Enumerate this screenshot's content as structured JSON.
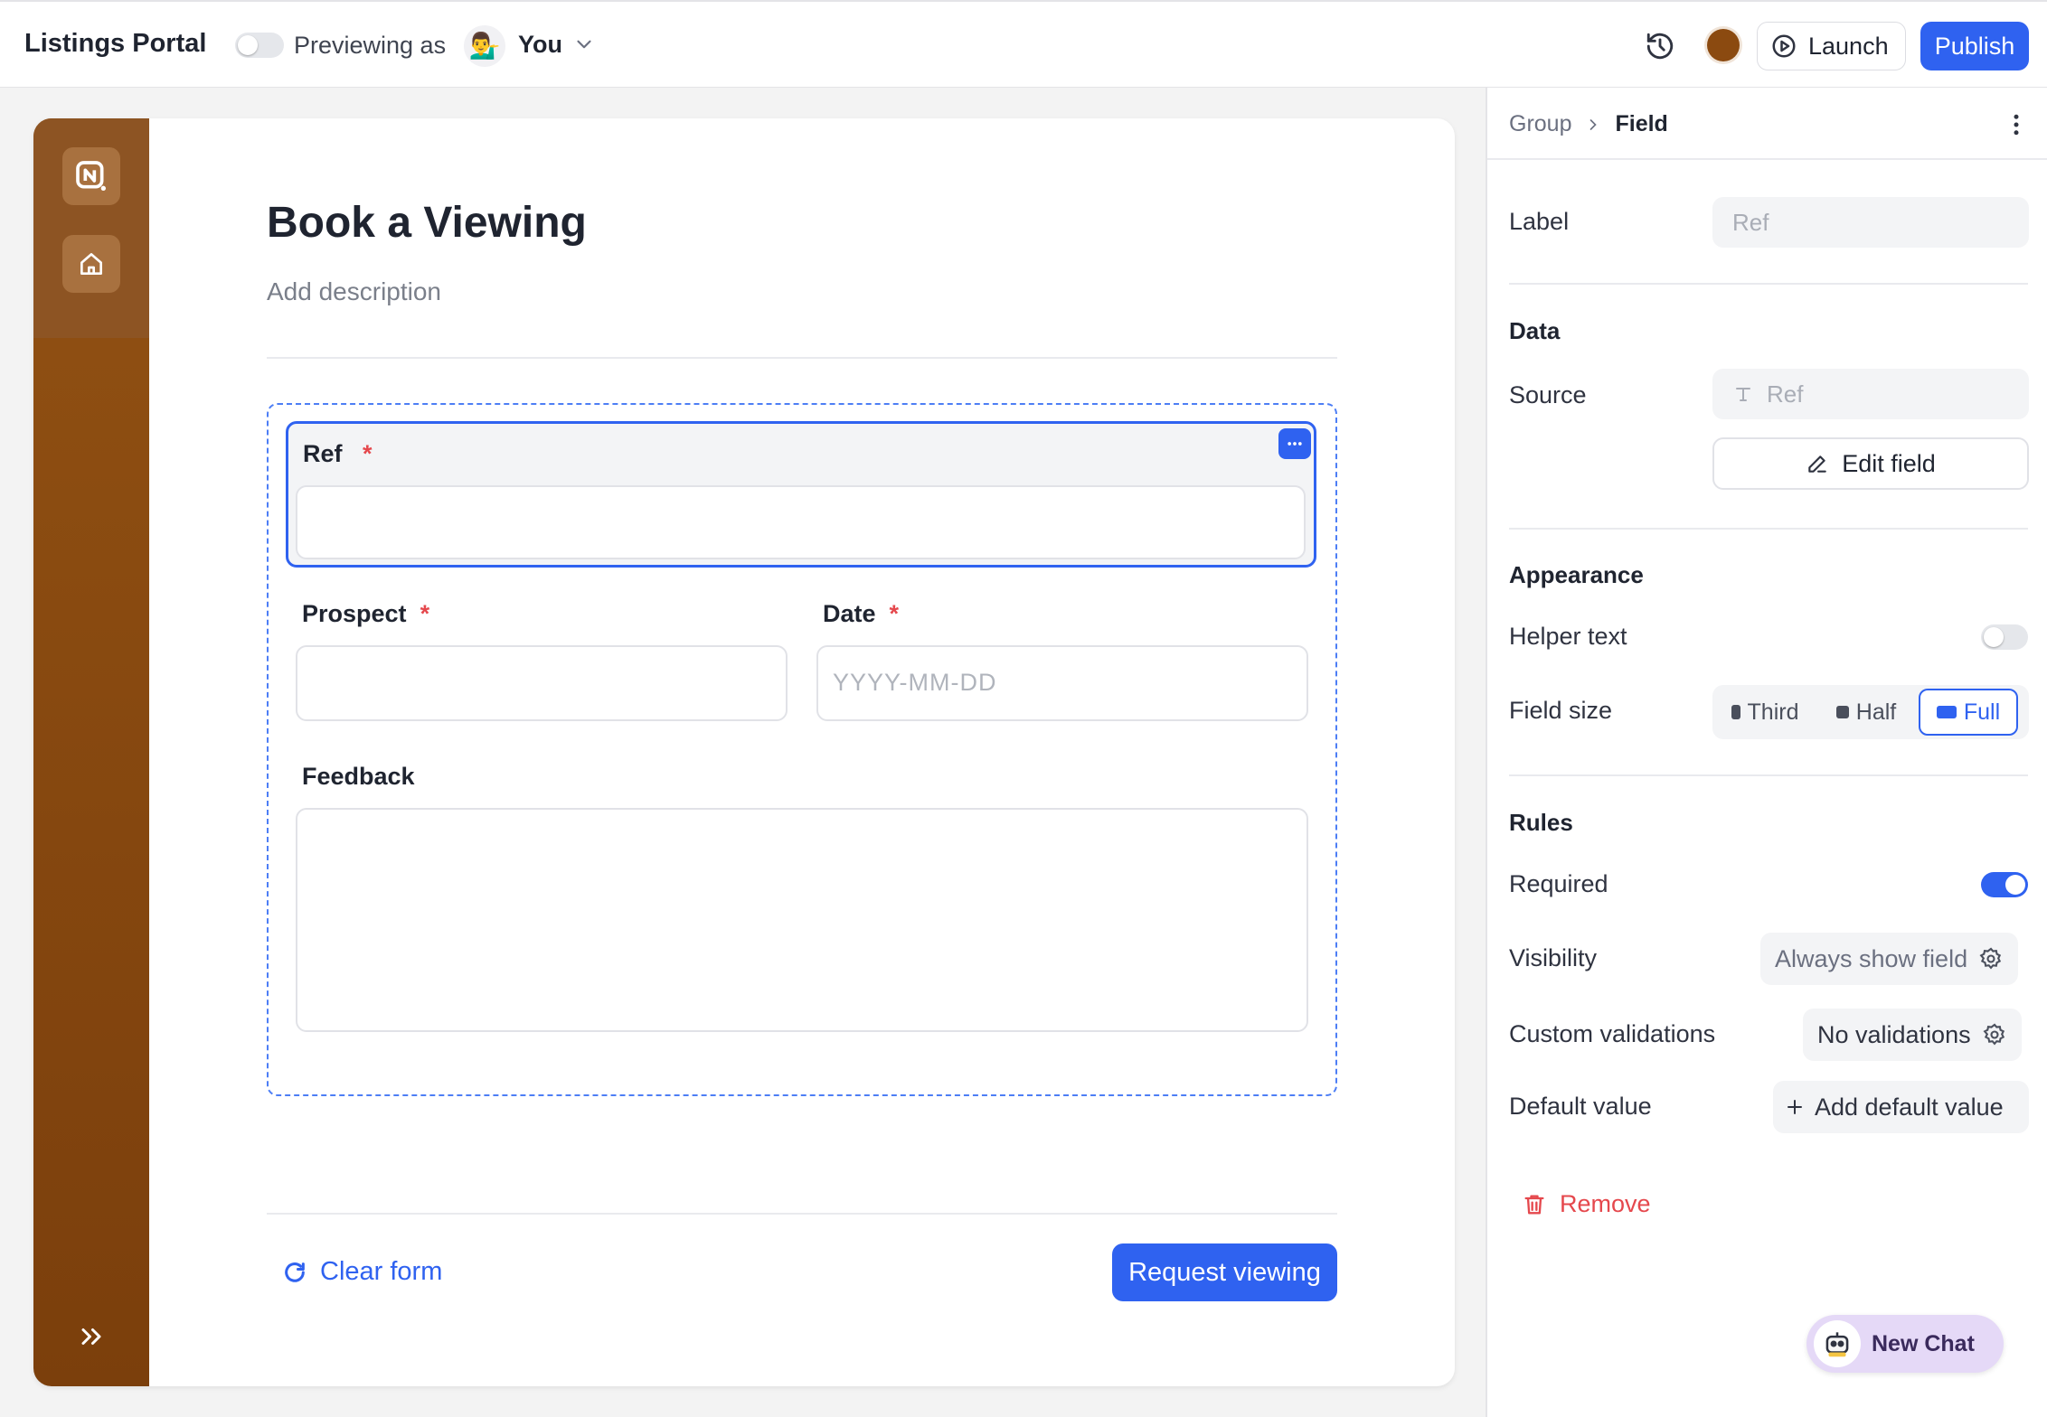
{
  "topbar": {
    "app_title": "Listings Portal",
    "preview_label": "Previewing as",
    "user_emoji": "💁‍♂️",
    "user_name": "You",
    "launch_label": "Launch",
    "publish_label": "Publish",
    "theme_color": "#8b4a10"
  },
  "form": {
    "title": "Book a Viewing",
    "description": "Add description",
    "fields": {
      "ref": {
        "label": "Ref",
        "required": "*"
      },
      "prospect": {
        "label": "Prospect",
        "required": "*"
      },
      "date": {
        "label": "Date",
        "required": "*",
        "placeholder": "YYYY-MM-DD"
      },
      "feedback": {
        "label": "Feedback"
      }
    },
    "clear_label": "Clear form",
    "submit_label": "Request viewing"
  },
  "panel": {
    "breadcrumb": {
      "parent": "Group",
      "current": "Field"
    },
    "label_label": "Label",
    "label_value": "Ref",
    "data_section": "Data",
    "source_label": "Source",
    "source_value": "Ref",
    "edit_field_label": "Edit field",
    "appearance_section": "Appearance",
    "helper_text_label": "Helper text",
    "helper_text_enabled": false,
    "field_size_label": "Field size",
    "field_size_options": [
      "Third",
      "Half",
      "Full"
    ],
    "field_size_selected": "Full",
    "rules_section": "Rules",
    "required_label": "Required",
    "required_enabled": true,
    "visibility_label": "Visibility",
    "visibility_value": "Always show field",
    "custom_validations_label": "Custom validations",
    "custom_validations_value": "No validations",
    "default_value_label": "Default value",
    "default_value_action": "Add default value",
    "remove_label": "Remove"
  },
  "chat": {
    "label": "New Chat"
  },
  "colors": {
    "accent": "#2f62f0",
    "danger": "#e5484d",
    "sidebar": "#8a4d15"
  }
}
